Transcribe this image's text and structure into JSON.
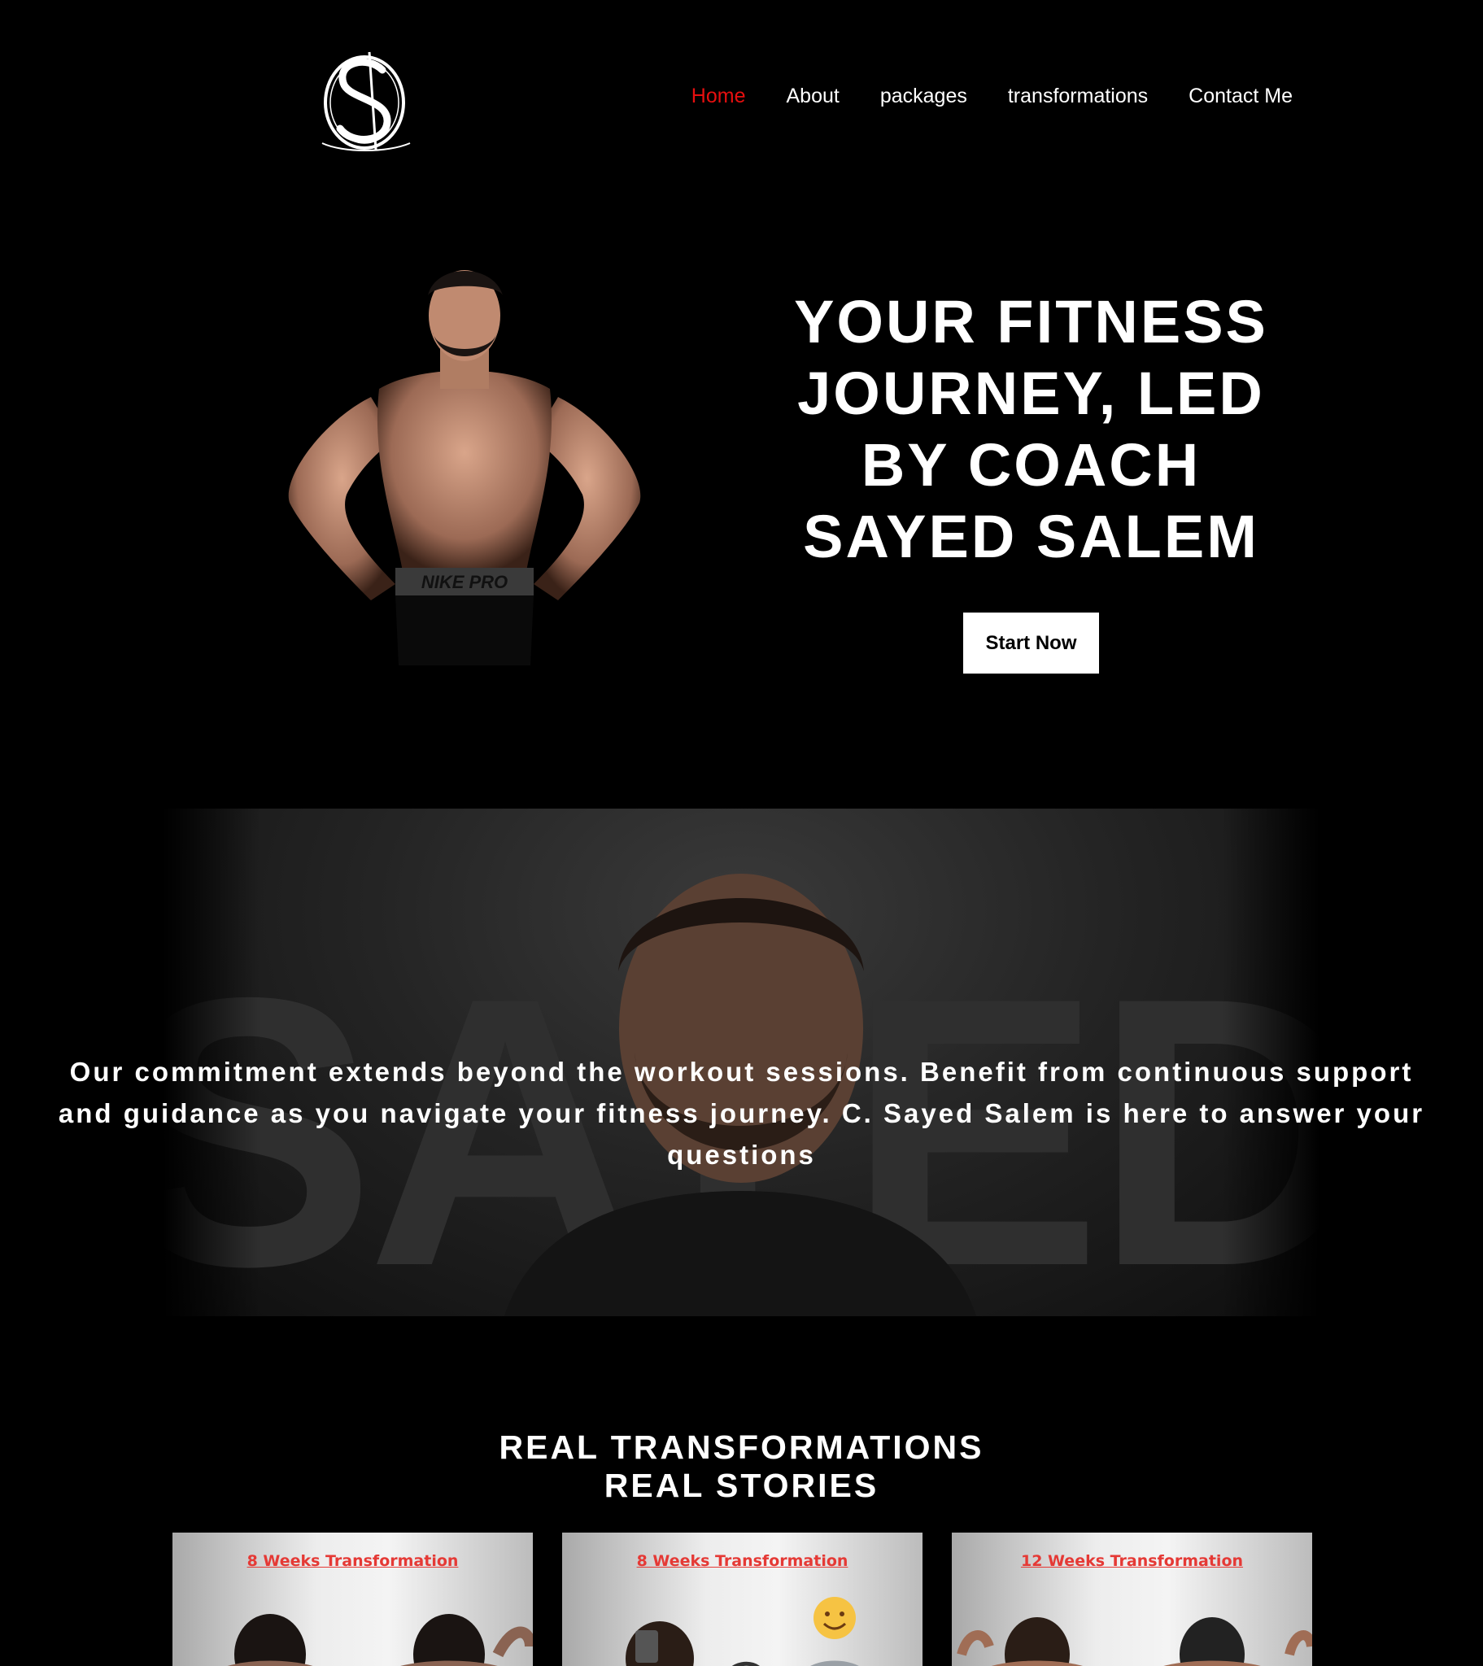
{
  "header": {
    "logo_icon": "ss-monogram-logo",
    "nav": [
      {
        "label": "Home",
        "active": true
      },
      {
        "label": "About",
        "active": false
      },
      {
        "label": "packages",
        "active": false
      },
      {
        "label": "transformations",
        "active": false
      },
      {
        "label": "Contact Me",
        "active": false
      }
    ]
  },
  "hero": {
    "title_lines": [
      "YOUR FITNESS",
      "JOURNEY, LED",
      "BY COACH",
      "SAYED SALEM"
    ],
    "cta_label": "Start Now"
  },
  "banner": {
    "text": "Our commitment extends beyond the workout sessions. Benefit from continuous support and guidance as you navigate your fitness journey. C. Sayed Salem is here to answer your questions"
  },
  "transformations": {
    "title_line1": "REAL TRANSFORMATIONS",
    "title_line2": "REAL STORIES",
    "cards": [
      {
        "label": "8 Weeks Transformation"
      },
      {
        "label": "8 Weeks Transformation"
      },
      {
        "label": "12 Weeks Transformation"
      }
    ]
  },
  "colors": {
    "background": "#000000",
    "text": "#ffffff",
    "accent": "#e60f0f",
    "card_label": "#e53935"
  }
}
